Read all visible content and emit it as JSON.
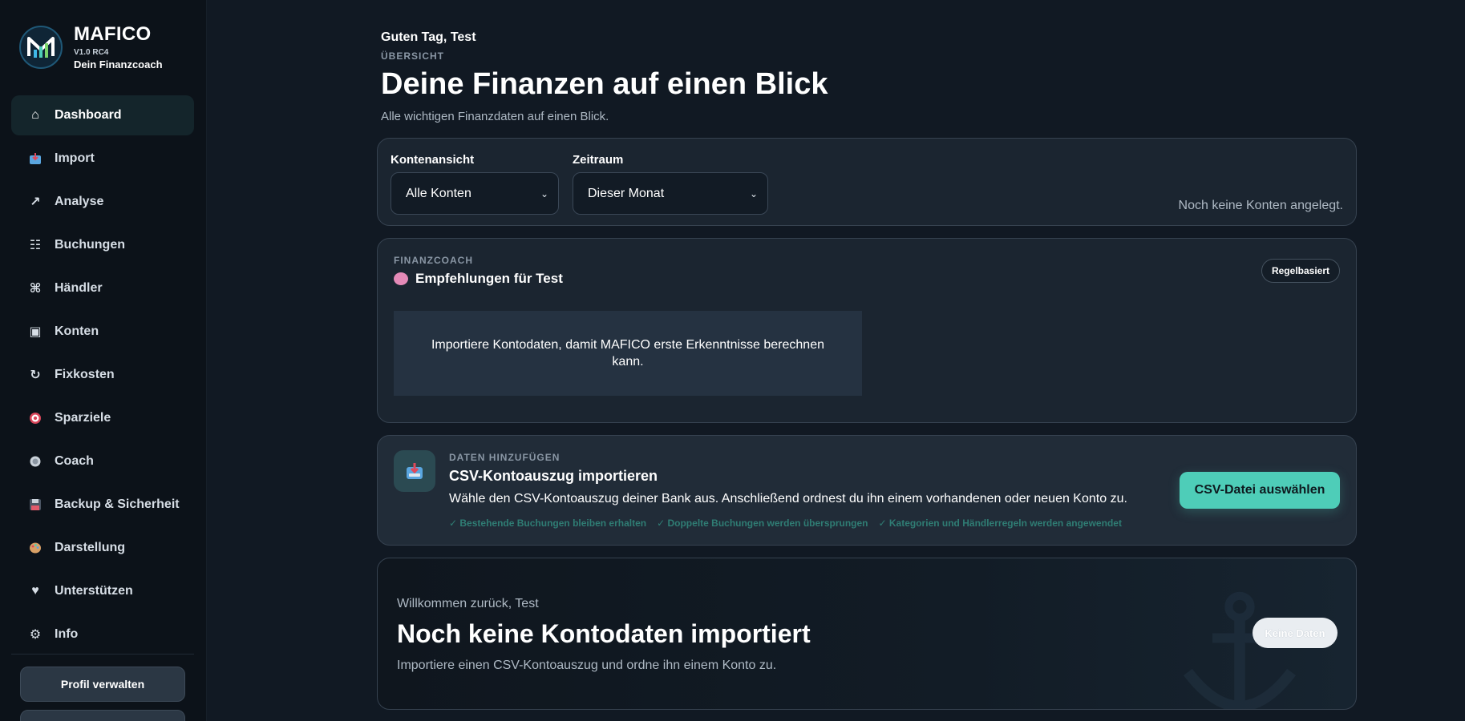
{
  "brand": {
    "name": "MAFICO",
    "version": "V1.0 RC4",
    "tagline": "Dein Finanzcoach"
  },
  "sidebar": {
    "items": [
      {
        "label": "Dashboard",
        "icon": "home-icon",
        "active": true
      },
      {
        "label": "Import",
        "icon": "inbox-tray-icon"
      },
      {
        "label": "Analyse",
        "icon": "trend-arrow-icon"
      },
      {
        "label": "Buchungen",
        "icon": "list-icon"
      },
      {
        "label": "Händler",
        "icon": "command-icon"
      },
      {
        "label": "Konten",
        "icon": "account-card-icon"
      },
      {
        "label": "Fixkosten",
        "icon": "repeat-icon"
      },
      {
        "label": "Sparziele",
        "icon": "target-icon"
      },
      {
        "label": "Coach",
        "icon": "coach-icon"
      },
      {
        "label": "Backup & Sicherheit",
        "icon": "floppy-disk-icon"
      },
      {
        "label": "Darstellung",
        "icon": "palette-icon"
      },
      {
        "label": "Unterstützen",
        "icon": "heart-icon"
      },
      {
        "label": "Info",
        "icon": "gear-icon"
      }
    ],
    "profile_button": "Profil verwalten"
  },
  "header": {
    "greeting": "Guten Tag, Test",
    "eyebrow": "ÜBERSICHT",
    "title": "Deine Finanzen auf einen Blick",
    "subtitle": "Alle wichtigen Finanzdaten auf einen Blick."
  },
  "filters": {
    "account_label": "Kontenansicht",
    "account_value": "Alle Konten",
    "period_label": "Zeitraum",
    "period_value": "Dieser Monat",
    "empty_note": "Noch keine Konten angelegt."
  },
  "coach": {
    "eyebrow": "FINANZCOACH",
    "title": "Empfehlungen für Test",
    "badge": "Regelbasiert",
    "message": "Importiere Kontodaten, damit MAFICO erste Erkenntnisse berechnen kann."
  },
  "import": {
    "eyebrow": "DATEN HINZUFÜGEN",
    "title": "CSV-Kontoauszug importieren",
    "description": "Wähle den CSV-Kontoauszug deiner Bank aus. Anschließend ordnest du ihn einem vorhandenen oder neuen Konto zu.",
    "checks": [
      "✓ Bestehende Buchungen bleiben erhalten",
      "✓ Doppelte Buchungen werden übersprungen",
      "✓ Kategorien und Händlerregeln werden angewendet"
    ],
    "button": "CSV-Datei auswählen"
  },
  "welcome": {
    "kicker": "Willkommen zurück, Test",
    "title": "Noch keine Kontodaten importiert",
    "subtitle": "Importiere einen CSV-Kontoauszug und ordne ihn einem Konto zu.",
    "badge": "Keine Daten"
  },
  "colors": {
    "accent": "#4ecdb8",
    "background": "#111923",
    "sidebar": "#0c1219",
    "card": "#1b2530"
  }
}
